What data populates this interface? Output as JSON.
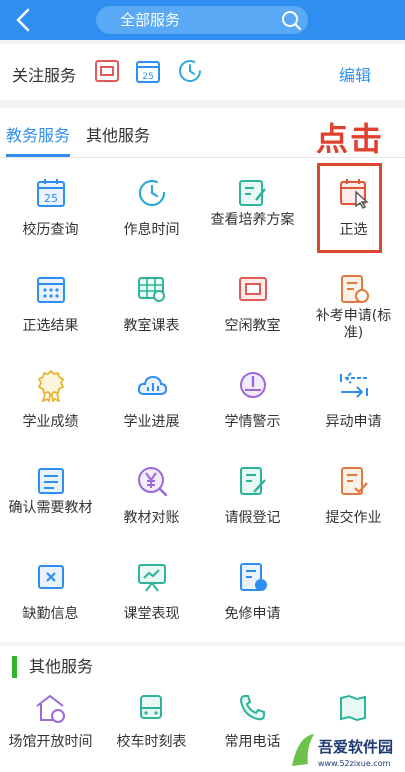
{
  "header": {
    "search_label": "全部服务"
  },
  "follow": {
    "label": "关注服务",
    "edit_label": "编辑",
    "calendar_number": "25"
  },
  "tabs": [
    {
      "label": "教务服务"
    },
    {
      "label": "其他服务"
    }
  ],
  "annotation": "点击",
  "grid": [
    {
      "label": "校历查询",
      "icon": "calendar-25-icon",
      "calendar_number": "25"
    },
    {
      "label": "作息时间",
      "icon": "clock-icon"
    },
    {
      "label": "查看培养方案",
      "icon": "edit-document-icon"
    },
    {
      "label": "正选",
      "icon": "calendar-click-icon"
    },
    {
      "label": "正选结果",
      "icon": "calendar-grid-icon"
    },
    {
      "label": "教室课表",
      "icon": "classroom-table-icon"
    },
    {
      "label": "空闲教室",
      "icon": "empty-room-icon"
    },
    {
      "label": "补考申请(标准)",
      "icon": "makeup-exam-icon"
    },
    {
      "label": "学业成绩",
      "icon": "award-icon"
    },
    {
      "label": "学业进展",
      "icon": "cloud-chart-icon"
    },
    {
      "label": "学情警示",
      "icon": "warning-gauge-icon"
    },
    {
      "label": "异动申请",
      "icon": "transfer-arrows-icon"
    },
    {
      "label": "确认需要教材",
      "icon": "textbook-icon"
    },
    {
      "label": "教材对账",
      "icon": "yen-icon"
    },
    {
      "label": "请假登记",
      "icon": "leave-register-icon"
    },
    {
      "label": "提交作业",
      "icon": "submit-homework-icon"
    },
    {
      "label": "缺勤信息",
      "icon": "absence-icon"
    },
    {
      "label": "课堂表现",
      "icon": "class-performance-icon"
    },
    {
      "label": "免修申请",
      "icon": "exemption-icon"
    }
  ],
  "other": {
    "title": "其他服务",
    "items": [
      {
        "label": "场馆开放时间",
        "icon": "venue-clock-icon"
      },
      {
        "label": "校车时刻表",
        "icon": "bus-icon"
      },
      {
        "label": "常用电话",
        "icon": "phone-icon"
      },
      {
        "label": "",
        "icon": "map-icon"
      }
    ]
  },
  "watermark": {
    "brand": "吾爱软件园",
    "url": "www.52zixue.com"
  },
  "colors": {
    "primary": "#2f8ff0",
    "accent_red": "#e0412f",
    "green": "#31b32c"
  }
}
